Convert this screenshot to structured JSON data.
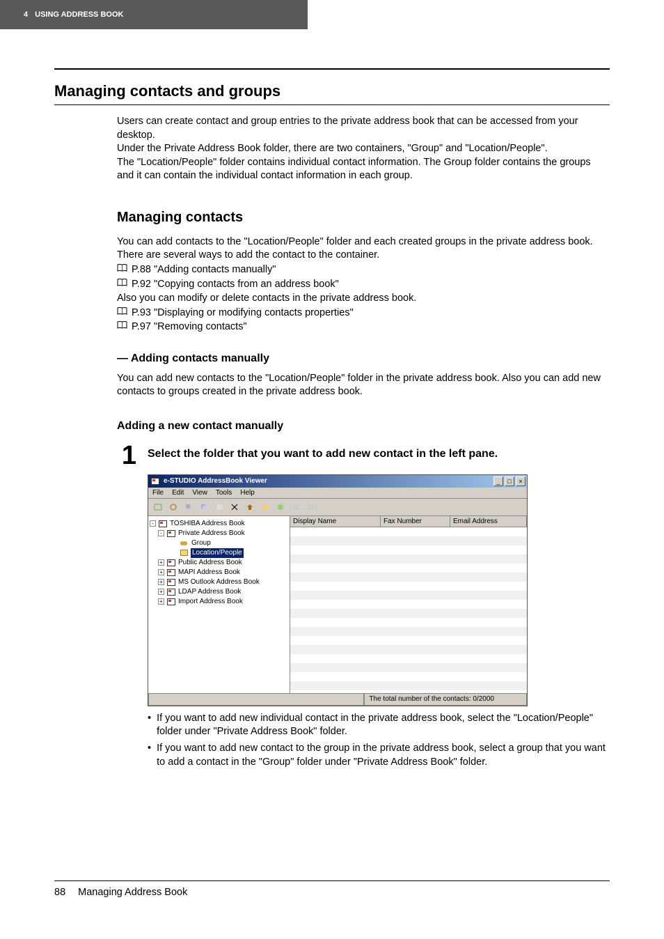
{
  "header": {
    "chapter_num": "4",
    "chapter_title": "USING ADDRESS BOOK"
  },
  "h1": "Managing contacts and groups",
  "intro": {
    "p1": "Users can create contact and group entries to the private address book that can be accessed from your desktop.",
    "p2": "Under the Private Address Book folder, there are two containers, \"Group\" and \"Location/People\".",
    "p3": "The \"Location/People\" folder contains individual contact information. The Group folder contains the groups and it can contain the individual contact information in each group."
  },
  "h2": "Managing contacts",
  "sec1": {
    "p1": "You can add contacts to the \"Location/People\" folder and each created groups in the private address book.",
    "p2": "There are several ways to add the contact to the container.",
    "ref1": "P.88 \"Adding contacts manually\"",
    "ref2": "P.92 \"Copying contacts from an address book\"",
    "p3": "Also you can modify or delete contacts in the private address book.",
    "ref3": "P.93 \"Displaying or modifying contacts properties\"",
    "ref4": "P.97 \"Removing contacts\""
  },
  "h3": "— Adding contacts manually",
  "sec2": {
    "p1": "You can add new contacts to the \"Location/People\" folder in the private address book. Also you can add new contacts to groups created in the private address book."
  },
  "h4": "Adding a new contact manually",
  "step": {
    "num": "1",
    "text": "Select the folder that you want to add new contact in the left pane."
  },
  "bullets": {
    "b1": "If you want to add new individual contact in the private address book, select the \"Location/People\" folder under \"Private Address Book\" folder.",
    "b2": "If you want to add new contact to the group in the private address book, select a group that you want to add a contact in the \"Group\" folder under \"Private Address Book\" folder."
  },
  "footer": {
    "page": "88",
    "title": "Managing Address Book"
  },
  "win": {
    "title": "e-STUDIO AddressBook Viewer",
    "menu": [
      "File",
      "Edit",
      "View",
      "Tools",
      "Help"
    ],
    "tree": {
      "root": "TOSHIBA Address Book",
      "n1": "Private Address Book",
      "n1a": "Group",
      "n1b": "Location/People",
      "n2": "Public Address Book",
      "n3": "MAPI Address Book",
      "n4": "MS Outlook Address Book",
      "n5": "LDAP Address Book",
      "n6": "Import Address Book"
    },
    "cols": {
      "c1": "Display Name",
      "c2": "Fax Number",
      "c3": "Email Address"
    },
    "status": "The total number of the contacts: 0/2000"
  }
}
